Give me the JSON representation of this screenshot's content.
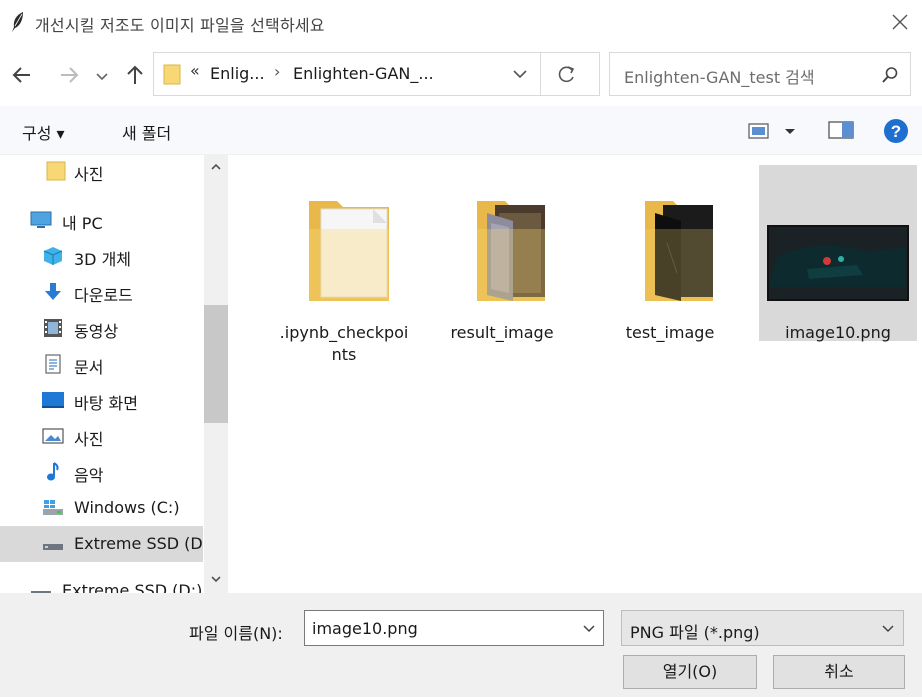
{
  "window": {
    "title": "개선시킬 저조도 이미지 파일을 선택하세요",
    "close_glyph": "✕"
  },
  "nav": {
    "address_overflow": "«",
    "breadcrumbs": [
      "Enlig...",
      "Enlighten-GAN_..."
    ],
    "separator": "›",
    "search_placeholder": "Enlighten-GAN_test 검색"
  },
  "toolbar": {
    "organize_label": "구성 ▾",
    "new_folder_label": "새 폴더"
  },
  "sidebar": {
    "items": [
      {
        "label": "사진",
        "icon": "folder-icon"
      },
      {
        "label": "내 PC",
        "icon": "pc-icon"
      },
      {
        "label": "3D 개체",
        "icon": "3d-objects-icon"
      },
      {
        "label": "다운로드",
        "icon": "download-icon"
      },
      {
        "label": "동영상",
        "icon": "video-icon"
      },
      {
        "label": "문서",
        "icon": "document-icon"
      },
      {
        "label": "바탕 화면",
        "icon": "desktop-icon"
      },
      {
        "label": "사진",
        "icon": "pictures-icon"
      },
      {
        "label": "음악",
        "icon": "music-icon"
      },
      {
        "label": "Windows (C:)",
        "icon": "windows-drive-icon"
      },
      {
        "label": "Extreme SSD (D",
        "icon": "drive-icon"
      },
      {
        "label": "Extreme SSD (D:)",
        "icon": "drive-icon"
      }
    ],
    "selected_index": 10
  },
  "files": [
    {
      "name": ".ipynb_checkpoints",
      "line1": ".ipynb_checkpoi",
      "line2": "nts",
      "type": "folder-empty"
    },
    {
      "name": "result_image",
      "line1": "result_image",
      "line2": "",
      "type": "folder-images"
    },
    {
      "name": "test_image",
      "line1": "test_image",
      "line2": "",
      "type": "folder-images-dark"
    },
    {
      "name": "image10.png",
      "line1": "image10.png",
      "line2": "",
      "type": "image",
      "selected": true
    }
  ],
  "bottom": {
    "filename_label": "파일 이름(N):",
    "filename_value": "image10.png",
    "filter_value": "PNG 파일 (*.png)",
    "open_label": "열기(O)",
    "cancel_label": "취소"
  },
  "colors": {
    "accent": "#0078d7",
    "folder": "#f8d775",
    "selection": "#d9d9d9"
  }
}
